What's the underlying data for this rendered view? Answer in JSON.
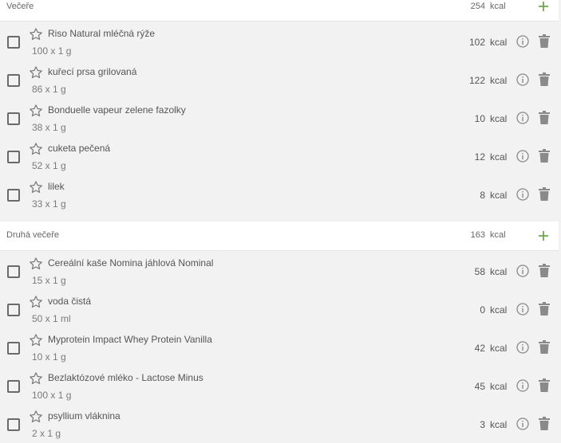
{
  "colors": {
    "accent": "#6aa84f",
    "icon": "#8a8a8a",
    "background": "#f2f2f2",
    "header": "#ffffff"
  },
  "sections": [
    {
      "title": "Večeře",
      "kcal": "254",
      "unit": "kcal",
      "items": [
        {
          "name": "Riso Natural mléčná rýže",
          "qty": "100 x 1 g",
          "kcal": "102",
          "unit": "kcal"
        },
        {
          "name": "kuřecí prsa grilovaná",
          "qty": "86 x 1 g",
          "kcal": "122",
          "unit": "kcal"
        },
        {
          "name": "Bonduelle vapeur zelene fazolky",
          "qty": "38 x 1 g",
          "kcal": "10",
          "unit": "kcal"
        },
        {
          "name": "cuketa pečená",
          "qty": "52 x 1 g",
          "kcal": "12",
          "unit": "kcal"
        },
        {
          "name": "lilek",
          "qty": "33 x 1 g",
          "kcal": "8",
          "unit": "kcal"
        }
      ]
    },
    {
      "title": "Druhá večeře",
      "kcal": "163",
      "unit": "kcal",
      "items": [
        {
          "name": "Cereální kaše Nomina jáhlová Nominal",
          "qty": "15 x 1 g",
          "kcal": "58",
          "unit": "kcal"
        },
        {
          "name": "voda čistá",
          "qty": "50 x 1 ml",
          "kcal": "0",
          "unit": "kcal"
        },
        {
          "name": "Myprotein Impact Whey Protein Vanilla",
          "qty": "10 x 1 g",
          "kcal": "42",
          "unit": "kcal"
        },
        {
          "name": "Bezlaktózové mléko - Lactose Minus",
          "qty": "100 x 1 g",
          "kcal": "45",
          "unit": "kcal"
        },
        {
          "name": "psyllium vláknina",
          "qty": "2 x 1 g",
          "kcal": "3",
          "unit": "kcal"
        }
      ]
    }
  ]
}
